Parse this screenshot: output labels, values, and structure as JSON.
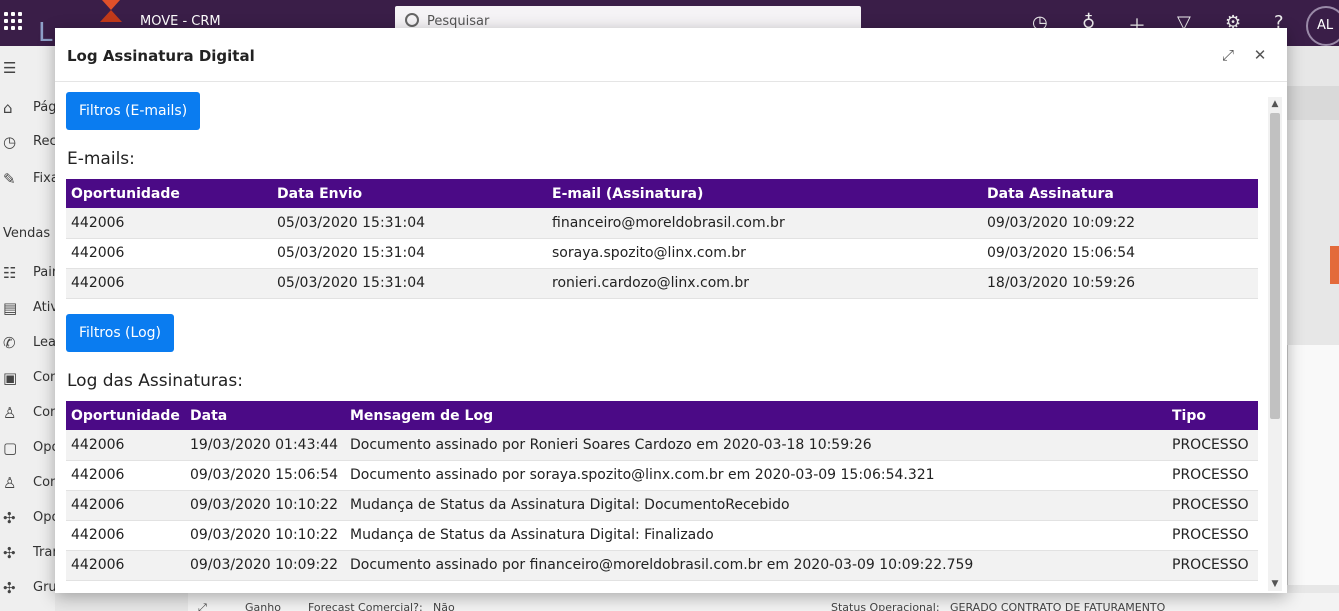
{
  "app": {
    "brand": "MOVE - CRM",
    "logo_letter": "L",
    "search_placeholder": "Pesquisar",
    "avatar_initials": "AL"
  },
  "sidebar": {
    "items_top": [
      {
        "label": "Pág",
        "icon": "home-icon",
        "glyph": "⌂"
      },
      {
        "label": "Rec",
        "icon": "clock-icon",
        "glyph": "◷"
      },
      {
        "label": "Fixa",
        "icon": "pin-icon",
        "glyph": "✎"
      }
    ],
    "section": "Vendas",
    "items": [
      {
        "label": "Pain",
        "icon": "dashboard-icon",
        "glyph": "☷"
      },
      {
        "label": "Ativ",
        "icon": "activity-icon",
        "glyph": "▤"
      },
      {
        "label": "Lea",
        "icon": "phone-icon",
        "glyph": "✆"
      },
      {
        "label": "Con",
        "icon": "contact-book-icon",
        "glyph": "▣"
      },
      {
        "label": "Con",
        "icon": "person-icon",
        "glyph": "♙"
      },
      {
        "label": "Opo",
        "icon": "opportunity-icon",
        "glyph": "▢"
      },
      {
        "label": "Con",
        "icon": "person-outline-icon",
        "glyph": "♙"
      },
      {
        "label": "Opo",
        "icon": "puzzle-icon",
        "glyph": "✣"
      },
      {
        "label": "Tran",
        "icon": "puzzle-icon",
        "glyph": "✣"
      },
      {
        "label": "Gru",
        "icon": "puzzle-icon",
        "glyph": "✣"
      }
    ]
  },
  "footer": {
    "items": [
      "Ganho",
      "Forecast Comercial?:",
      "Não",
      "Status Operacional:",
      "GERADO CONTRATO DE FATURAMENTO"
    ]
  },
  "modal": {
    "title": "Log Assinatura Digital",
    "expand_glyph": "⤢",
    "close_glyph": "✕",
    "filter_emails_label": "Filtros (E-mails)",
    "emails_title": "E-mails:",
    "emails_table": {
      "headers": [
        "Oportunidade",
        "Data Envio",
        "E-mail (Assinatura)",
        "Data Assinatura"
      ],
      "rows": [
        [
          "442006",
          "05/03/2020 15:31:04",
          "financeiro@moreldobrasil.com.br",
          "09/03/2020 10:09:22"
        ],
        [
          "442006",
          "05/03/2020 15:31:04",
          "soraya.spozito@linx.com.br",
          "09/03/2020 15:06:54"
        ],
        [
          "442006",
          "05/03/2020 15:31:04",
          "ronieri.cardozo@linx.com.br",
          "18/03/2020 10:59:26"
        ]
      ]
    },
    "filter_log_label": "Filtros (Log)",
    "log_title": "Log das Assinaturas:",
    "log_table": {
      "headers": [
        "Oportunidade",
        "Data",
        "Mensagem de Log",
        "Tipo"
      ],
      "rows": [
        [
          "442006",
          "19/03/2020 01:43:44",
          "Documento assinado por Ronieri Soares Cardozo em 2020-03-18 10:59:26",
          "PROCESSO"
        ],
        [
          "442006",
          "09/03/2020 15:06:54",
          "Documento assinado por soraya.spozito@linx.com.br em 2020-03-09 15:06:54.321",
          "PROCESSO"
        ],
        [
          "442006",
          "09/03/2020 10:10:22",
          "Mudança de Status da Assinatura Digital: DocumentoRecebido",
          "PROCESSO"
        ],
        [
          "442006",
          "09/03/2020 10:10:22",
          "Mudança de Status da Assinatura Digital: Finalizado",
          "PROCESSO"
        ],
        [
          "442006",
          "09/03/2020 10:09:22",
          "Documento assinado por financeiro@moreldobrasil.com.br em 2020-03-09 10:09:22.759",
          "PROCESSO"
        ]
      ]
    }
  },
  "colors": {
    "header_purple": "#4b0a86",
    "button_blue": "#0a7cf0",
    "topbar": "#3a1e48"
  }
}
